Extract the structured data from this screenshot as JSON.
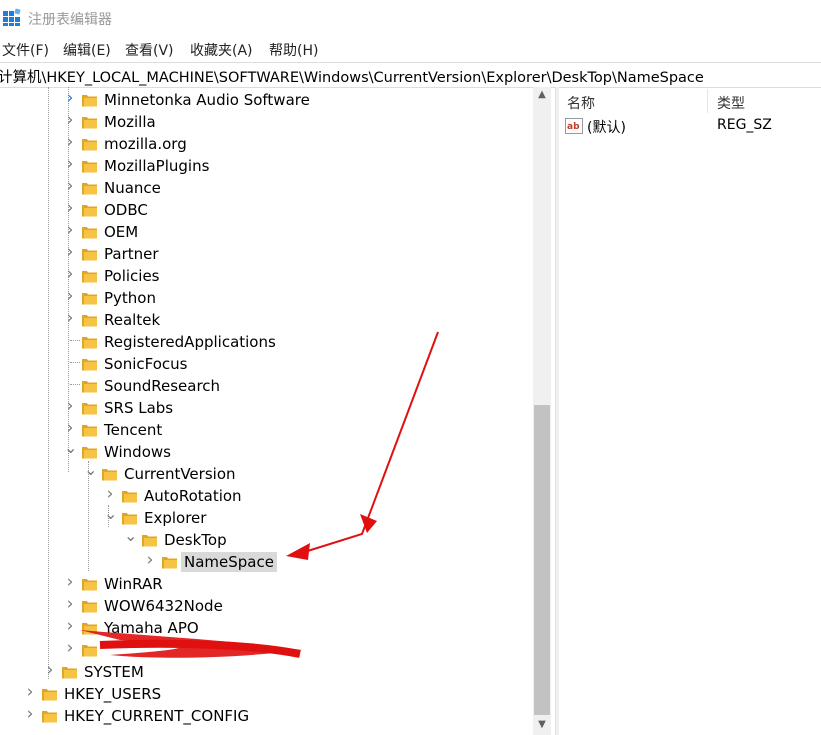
{
  "window": {
    "title": "注册表编辑器"
  },
  "menu": [
    "文件(F)",
    "编辑(E)",
    "查看(V)",
    "收藏夹(A)",
    "帮助(H)"
  ],
  "address": "计算机\\HKEY_LOCAL_MACHINE\\SOFTWARE\\Windows\\CurrentVersion\\Explorer\\DeskTop\\NameSpace",
  "tree": [
    {
      "label": "Minnetonka Audio Software",
      "level": 2,
      "expander": "collapsed",
      "accent": true
    },
    {
      "label": "Mozilla",
      "level": 2,
      "expander": "collapsed"
    },
    {
      "label": "mozilla.org",
      "level": 2,
      "expander": "collapsed"
    },
    {
      "label": "MozillaPlugins",
      "level": 2,
      "expander": "collapsed"
    },
    {
      "label": "Nuance",
      "level": 2,
      "expander": "collapsed"
    },
    {
      "label": "ODBC",
      "level": 2,
      "expander": "collapsed"
    },
    {
      "label": "OEM",
      "level": 2,
      "expander": "collapsed"
    },
    {
      "label": "Partner",
      "level": 2,
      "expander": "collapsed"
    },
    {
      "label": "Policies",
      "level": 2,
      "expander": "collapsed"
    },
    {
      "label": "Python",
      "level": 2,
      "expander": "collapsed"
    },
    {
      "label": "Realtek",
      "level": 2,
      "expander": "collapsed"
    },
    {
      "label": "RegisteredApplications",
      "level": 2,
      "expander": "none"
    },
    {
      "label": "SonicFocus",
      "level": 2,
      "expander": "none"
    },
    {
      "label": "SoundResearch",
      "level": 2,
      "expander": "none"
    },
    {
      "label": "SRS Labs",
      "level": 2,
      "expander": "collapsed"
    },
    {
      "label": "Tencent",
      "level": 2,
      "expander": "collapsed"
    },
    {
      "label": "Windows",
      "level": 2,
      "expander": "expanded"
    },
    {
      "label": "CurrentVersion",
      "level": 3,
      "expander": "expanded"
    },
    {
      "label": "AutoRotation",
      "level": 4,
      "expander": "collapsed"
    },
    {
      "label": "Explorer",
      "level": 4,
      "expander": "expanded"
    },
    {
      "label": "DeskTop",
      "level": 5,
      "expander": "expanded"
    },
    {
      "label": "NameSpace",
      "level": 6,
      "expander": "collapsed",
      "selected": true
    },
    {
      "label": "WinRAR",
      "level": 2,
      "expander": "collapsed"
    },
    {
      "label": "WOW6432Node",
      "level": 2,
      "expander": "collapsed"
    },
    {
      "label": "Yamaha APO",
      "level": 2,
      "expander": "collapsed"
    },
    {
      "label": "",
      "level": 2,
      "expander": "collapsed"
    },
    {
      "label": "SYSTEM",
      "level": 1,
      "expander": "collapsed"
    },
    {
      "label": "HKEY_USERS",
      "level": 0,
      "expander": "collapsed"
    },
    {
      "label": "HKEY_CURRENT_CONFIG",
      "level": 0,
      "expander": "collapsed"
    }
  ],
  "values_header": {
    "name": "名称",
    "type": "类型"
  },
  "values": [
    {
      "name": "(默认)",
      "type": "REG_SZ"
    }
  ],
  "colors": {
    "folder": "#f6c343",
    "folder_dark": "#dfa62a",
    "selection": "#d9d9d9",
    "annotation": "#e01010",
    "icon_blue": "#1e7fd6"
  }
}
